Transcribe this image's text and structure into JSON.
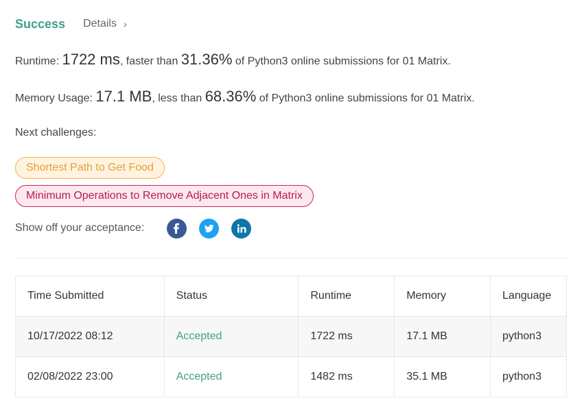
{
  "header": {
    "status": "Success",
    "details": "Details",
    "colors": {
      "success": "#3f9f8b"
    }
  },
  "runtime": {
    "label": "Runtime: ",
    "value": "1722 ms",
    "middle": ", faster than ",
    "percent": "31.36%",
    "suffix": " of Python3 online submissions for 01 Matrix."
  },
  "memory": {
    "label": "Memory Usage: ",
    "value": "17.1 MB",
    "middle": ", less than ",
    "percent": "68.36%",
    "suffix": " of Python3 online submissions for 01 Matrix."
  },
  "next_challenges": {
    "label": "Next challenges:",
    "items": [
      {
        "title": "Shortest Path to Get Food",
        "difficulty_color": "#e6a035"
      },
      {
        "title": "Minimum Operations to Remove Adjacent Ones in Matrix",
        "difficulty_color": "#b51c56"
      }
    ]
  },
  "share": {
    "label": "Show off your acceptance:",
    "icons": [
      "facebook-icon",
      "twitter-icon",
      "linkedin-icon"
    ]
  },
  "submissions": {
    "headers": [
      "Time Submitted",
      "Status",
      "Runtime",
      "Memory",
      "Language"
    ],
    "rows": [
      {
        "time": "10/17/2022 08:12",
        "status": "Accepted",
        "runtime": "1722 ms",
        "memory": "17.1 MB",
        "language": "python3"
      },
      {
        "time": "02/08/2022 23:00",
        "status": "Accepted",
        "runtime": "1482 ms",
        "memory": "35.1 MB",
        "language": "python3"
      }
    ]
  }
}
